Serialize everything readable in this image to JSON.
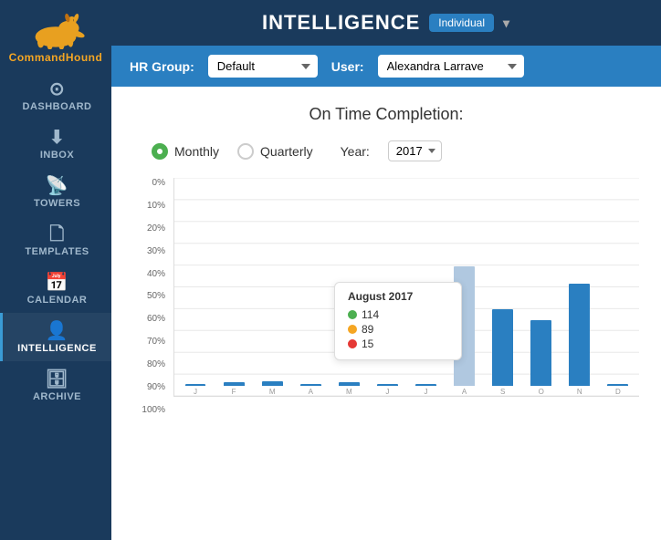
{
  "topbar": {
    "title": "INTELLIGENCE",
    "badge": "Individual",
    "dropdown_arrow": "▾"
  },
  "filterbar": {
    "hr_group_label": "HR Group:",
    "hr_group_value": "Default",
    "user_label": "User:",
    "user_value": "Alexandra Larrave"
  },
  "content": {
    "section_title": "On Time Completion:",
    "monthly_label": "Monthly",
    "quarterly_label": "Quarterly",
    "year_label": "Year:",
    "year_value": "2017",
    "selected_radio": "monthly"
  },
  "chart": {
    "y_labels": [
      "100%",
      "90%",
      "80%",
      "70%",
      "60%",
      "50%",
      "40%",
      "30%",
      "20%",
      "10%",
      "0%"
    ],
    "bars": [
      {
        "month": "J",
        "value": 1,
        "highlighted": false
      },
      {
        "month": "F",
        "value": 1.5,
        "highlighted": false
      },
      {
        "month": "M",
        "value": 2,
        "highlighted": false
      },
      {
        "month": "A",
        "value": 1,
        "highlighted": false
      },
      {
        "month": "M",
        "value": 1.5,
        "highlighted": false
      },
      {
        "month": "J",
        "value": 1,
        "highlighted": false
      },
      {
        "month": "J",
        "value": 1,
        "highlighted": false
      },
      {
        "month": "A",
        "value": 55,
        "highlighted": true
      },
      {
        "month": "S",
        "value": 35,
        "highlighted": false
      },
      {
        "month": "O",
        "value": 30,
        "highlighted": false
      },
      {
        "month": "N",
        "value": 47,
        "highlighted": false
      },
      {
        "month": "D",
        "value": 1,
        "highlighted": false
      }
    ],
    "tooltip": {
      "title": "August 2017",
      "green_count": "114",
      "yellow_count": "89",
      "red_count": "15"
    }
  },
  "sidebar": {
    "logo_text_command": "Command",
    "logo_text_hound": "Hound",
    "nav_items": [
      {
        "id": "dashboard",
        "label": "DASHBOARD",
        "icon": "dashboard"
      },
      {
        "id": "inbox",
        "label": "INBOX",
        "icon": "inbox"
      },
      {
        "id": "towers",
        "label": "TOWERS",
        "icon": "towers"
      },
      {
        "id": "templates",
        "label": "TEMPLATES",
        "icon": "templates"
      },
      {
        "id": "calendar",
        "label": "CALENDAR",
        "icon": "calendar"
      },
      {
        "id": "intelligence",
        "label": "INTELLIGENCE",
        "icon": "intelligence"
      },
      {
        "id": "archive",
        "label": "ARCHIVE",
        "icon": "archive"
      }
    ]
  }
}
